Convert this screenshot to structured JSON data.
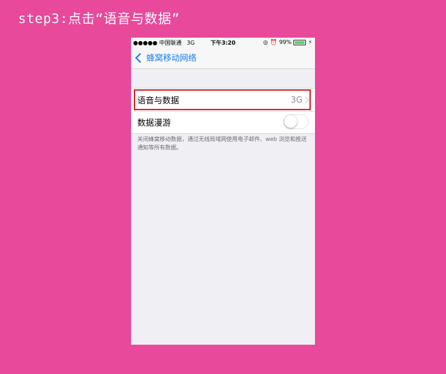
{
  "caption": "step3:点击“语音与数据”",
  "statusbar": {
    "signal": "●●●●● 中国联通",
    "network": "3G",
    "time": "下午3:20",
    "battery": "99%",
    "battery_level": 0.99
  },
  "navbar": {
    "back_label": "蜂窝移动网络"
  },
  "rows": [
    {
      "label": "语音与数据",
      "value": "3G"
    },
    {
      "label": "数据漫游",
      "toggle_on": false
    }
  ],
  "footer_text": "关闭蜂窝移动数据，通过无线局域网使用电子邮件、web 浏览和推送通知等所有数据。",
  "colors": {
    "background": "#e8499b",
    "accent": "#1a7cf5",
    "highlight": "#e0252b"
  }
}
